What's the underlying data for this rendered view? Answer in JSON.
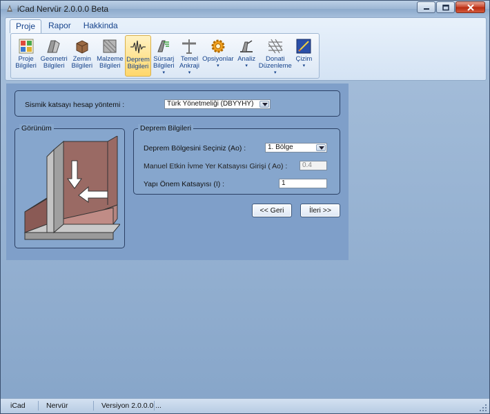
{
  "window": {
    "title": "iCad Nervür 2.0.0.0 Beta"
  },
  "ribbon": {
    "tabs": [
      {
        "label": "Proje"
      },
      {
        "label": "Rapor"
      },
      {
        "label": "Hakkinda"
      }
    ],
    "buttons": [
      {
        "line1": "Proje",
        "line2": "Bilgileri",
        "icon": "project-info-icon"
      },
      {
        "line1": "Geometri",
        "line2": "Bilgileri",
        "icon": "geometry-icon"
      },
      {
        "line1": "Zemin",
        "line2": "Bilgileri",
        "icon": "soil-icon"
      },
      {
        "line1": "Malzeme",
        "line2": "Bilgileri",
        "icon": "material-icon"
      },
      {
        "line1": "Deprem",
        "line2": "Bilgileri",
        "icon": "seismic-icon"
      },
      {
        "line1": "Sürsarj",
        "line2": "Bilgileri",
        "icon": "surcharge-icon"
      },
      {
        "line1": "Temel",
        "line2": "Ankraji",
        "icon": "anchor-icon"
      },
      {
        "line1": "Opsiyonlar",
        "line2": "",
        "icon": "gear-icon"
      },
      {
        "line1": "Analiz",
        "line2": "",
        "icon": "analysis-icon"
      },
      {
        "line1": "Donati",
        "line2": "Düzenleme",
        "icon": "rebar-icon"
      },
      {
        "line1": "Çizim",
        "line2": "",
        "icon": "drawing-icon"
      }
    ]
  },
  "method": {
    "label": "Sismik katsayı hesap yöntemi :",
    "value": "Türk Yönetmeliği (DBYYHY)"
  },
  "preview": {
    "title": "Görünüm"
  },
  "seismic": {
    "title": "Deprem Bilgileri",
    "zone_label": "Deprem Bölgesini Seçiniz  (Ao) :",
    "zone_value": "1. Bölge",
    "manual_label": "Manuel Etkin İvme Yer Katsayısı Girişi ( Ao) :",
    "manual_value": "0.4",
    "importance_label": "Yapı Önem Katsayısı (I) :",
    "importance_value": "1"
  },
  "nav": {
    "back": "<< Geri",
    "next": "İleri >>"
  },
  "status": {
    "items": [
      "iCad",
      "Nervür",
      "Versiyon 2.0.0.0 ..."
    ]
  }
}
